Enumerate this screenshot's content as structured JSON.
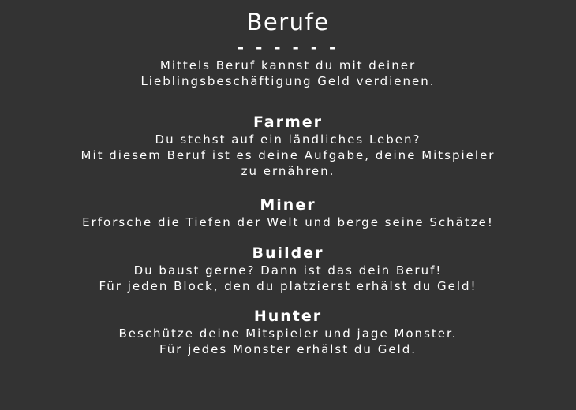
{
  "title": "Berufe",
  "divider": "- - - - - -",
  "intro": {
    "line1": "Mittels Beruf kannst du mit deiner",
    "line2": "Lieblingsbeschäftigung Geld verdienen."
  },
  "sections": [
    {
      "name": "Farmer",
      "lines": [
        "Du stehst auf ein ländliches Leben?",
        "Mit diesem Beruf ist es deine Aufgabe, deine Mitspieler",
        "zu ernähren."
      ]
    },
    {
      "name": "Miner",
      "lines": [
        "Erforsche die Tiefen der Welt und berge seine Schätze!"
      ]
    },
    {
      "name": "Builder",
      "lines": [
        "Du baust gerne? Dann ist das dein Beruf!",
        "Für jeden Block, den du platzierst erhälst du Geld!"
      ]
    },
    {
      "name": "Hunter",
      "lines": [
        "Beschütze deine Mitspieler und jage Monster.",
        "Für jedes Monster erhälst du Geld."
      ]
    }
  ],
  "colors": {
    "background": "#333333",
    "text": "#ffffff"
  }
}
